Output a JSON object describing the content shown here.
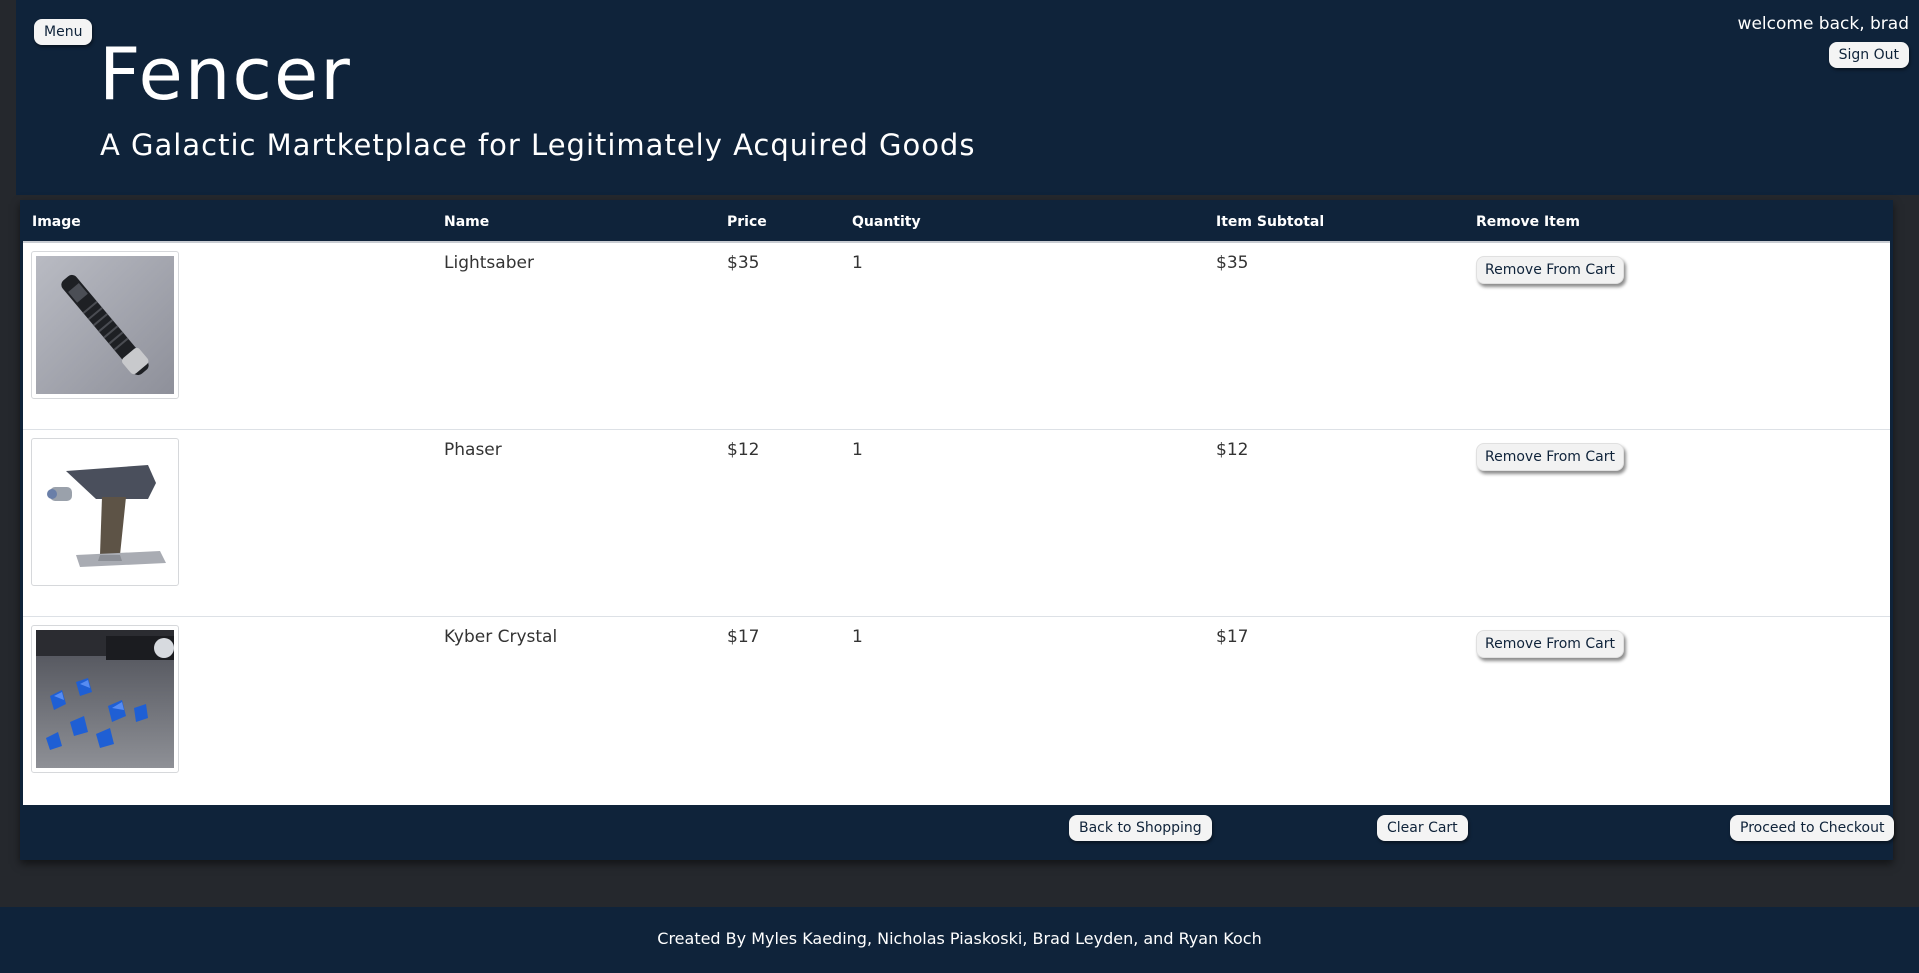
{
  "header": {
    "menu_label": "Menu",
    "title": "Fencer",
    "subtitle": "A Galactic Martketplace for Legitimately Acquired Goods",
    "welcome_text": "welcome back, brad",
    "signout_label": "Sign Out"
  },
  "cart": {
    "columns": [
      "Image",
      "Name",
      "Price",
      "Quantity",
      "Item Subtotal",
      "Remove Item"
    ],
    "items": [
      {
        "name": "Lightsaber",
        "price": "$35",
        "quantity": "1",
        "subtotal": "$35",
        "remove_label": "Remove From Cart",
        "image_icon": "lightsaber-image"
      },
      {
        "name": "Phaser",
        "price": "$12",
        "quantity": "1",
        "subtotal": "$12",
        "remove_label": "Remove From Cart",
        "image_icon": "phaser-image"
      },
      {
        "name": "Kyber Crystal",
        "price": "$17",
        "quantity": "1",
        "subtotal": "$17",
        "remove_label": "Remove From Cart",
        "image_icon": "kyber-crystal-image"
      }
    ],
    "actions": {
      "back_label": "Back to Shopping",
      "clear_label": "Clear Cart",
      "checkout_label": "Proceed to Checkout"
    }
  },
  "footer": {
    "credits": "Created By Myles Kaeding, Nicholas Piaskoski, Brad Leyden, and Ryan Koch"
  },
  "colors": {
    "navy": "#0f233a",
    "page_bg": "#25282d",
    "button_bg": "#f4f4f4"
  }
}
